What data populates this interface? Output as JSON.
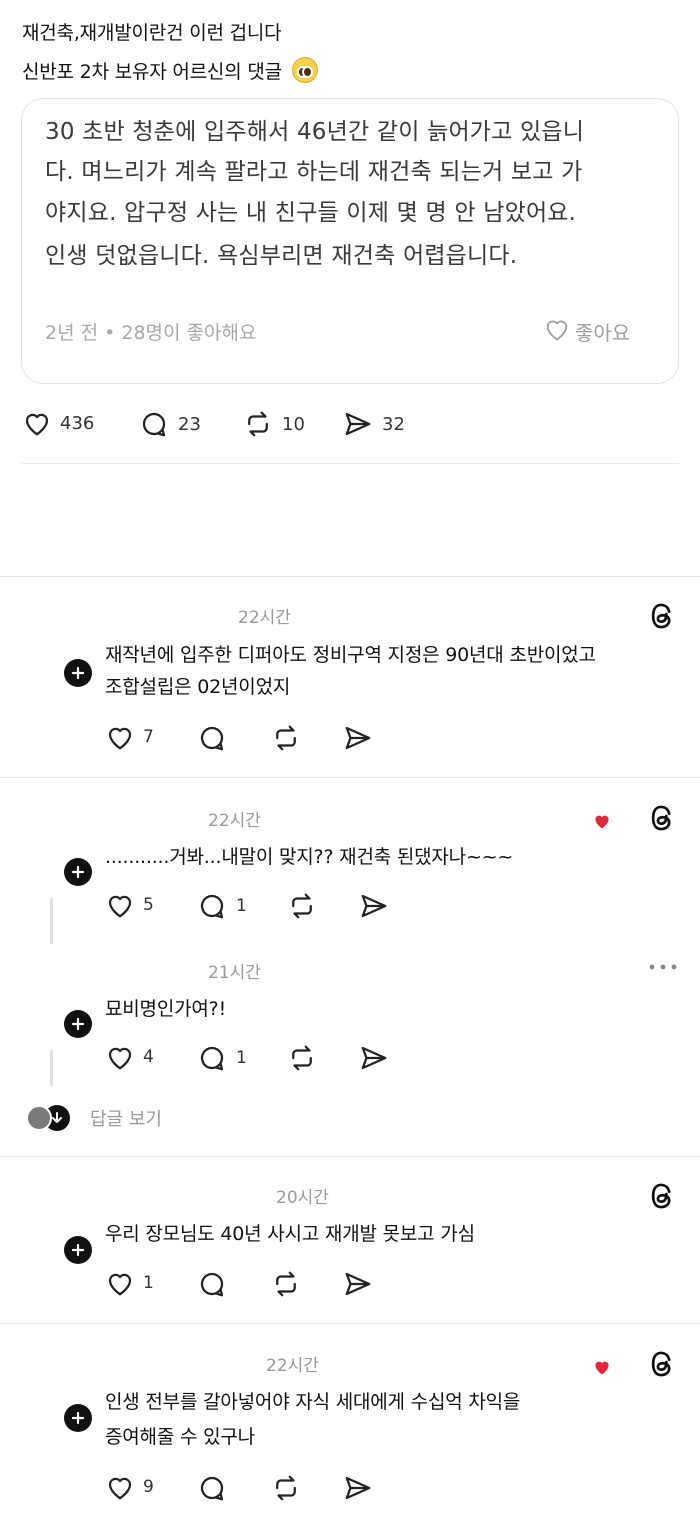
{
  "post": {
    "line1": "재건축,재개발이란건 이런 겁니다",
    "line2": "신반포 2차 보유자 어르신의 댓글",
    "emoji_icon": "pleading-face-icon"
  },
  "quote": {
    "lines": [
      "30 초반 청춘에 입주해서 46년간 같이 늙어가고 있읍니",
      "다.  며느리가 계속 팔라고 하는데 재건축 되는거 보고 가",
      "야지요.   압구정 사는 내 친구들 이제 몇 명 안 남았어요.",
      "인생 덧없읍니다.    욕심부리면 재건축 어렵읍니다."
    ],
    "meta": "2년 전 • 28명이 좋아해요",
    "like_label": "좋아요"
  },
  "stats": {
    "likes": "436",
    "comments": "23",
    "reposts": "10",
    "shares": "32"
  },
  "comments": [
    {
      "time": "22시간",
      "lines": [
        "재작년에 입주한 디퍼아도 정비구역 지정은 90년대 초반이었고",
        "조합설립은 02년이었지"
      ],
      "likes": "7",
      "replies": ""
    },
    {
      "time": "22시간",
      "lines": [
        "...........거봐...내말이 맞지?? 재건축 된댔자나~~~"
      ],
      "likes": "5",
      "replies": "1"
    },
    {
      "time": "21시간",
      "lines": [
        "묘비명인가여?!"
      ],
      "likes": "4",
      "replies": "1"
    },
    {
      "time": "20시간",
      "lines": [
        "우리 장모님도 40년 사시고 재개발 못보고 가심"
      ],
      "likes": "1",
      "replies": ""
    },
    {
      "time": "22시간",
      "lines": [
        "인생 전부를 갈아넣어야 자식 세대에게 수십억 차익을",
        "증여해줄 수 있구나"
      ],
      "likes": "9",
      "replies": ""
    }
  ],
  "view_replies": "답글 보기",
  "colors": {
    "heart_red": "#e0283b",
    "text": "#111111",
    "muted": "#999999"
  }
}
